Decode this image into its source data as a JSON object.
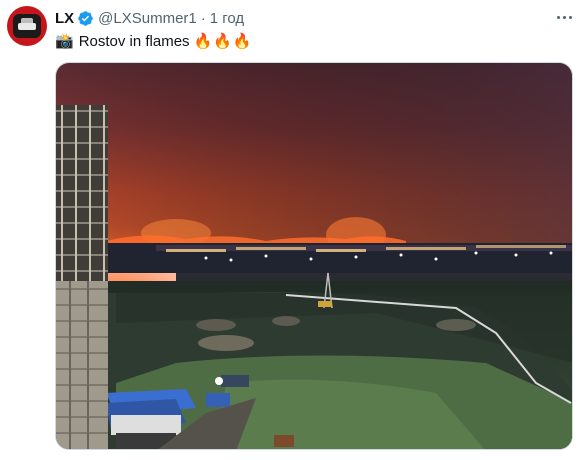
{
  "tweet": {
    "author_name": "LX",
    "author_handle": "@LXSummer1",
    "separator": "·",
    "timestamp": "1 год",
    "text": "Rostov in flames",
    "camera_emoji": "📸",
    "fire_emojis": "🔥🔥🔥"
  },
  "colors": {
    "verified": "#1d9bf0",
    "avatar": "#c5161d",
    "handle": "#536471"
  },
  "icons": {
    "verified": "verified-badge-icon",
    "more": "more-options-icon",
    "camera": "camera-flash-icon",
    "fire": "fire-icon"
  }
}
